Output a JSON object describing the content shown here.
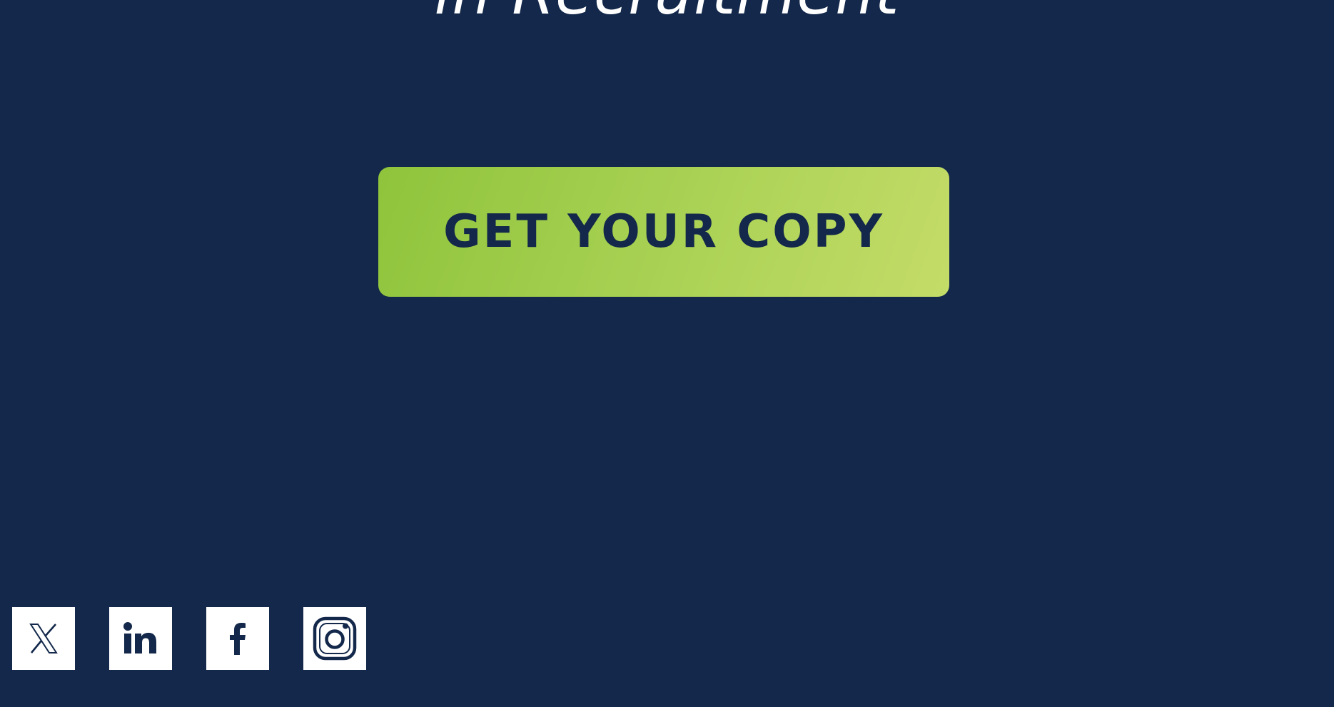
{
  "hero": {
    "title": "in Recruitment"
  },
  "cta": {
    "label": "GET YOUR COPY"
  },
  "social": [
    {
      "icon": "x-twitter-icon",
      "label": "X"
    },
    {
      "icon": "linkedin-icon",
      "label": "LinkedIn"
    },
    {
      "icon": "facebook-icon",
      "label": "Facebook"
    },
    {
      "icon": "instagram-icon",
      "label": "Instagram"
    }
  ],
  "colors": {
    "background": "#13284a",
    "accent_start": "#8fc43c",
    "accent_end": "#c4dc68",
    "icon_background": "#ffffff"
  }
}
